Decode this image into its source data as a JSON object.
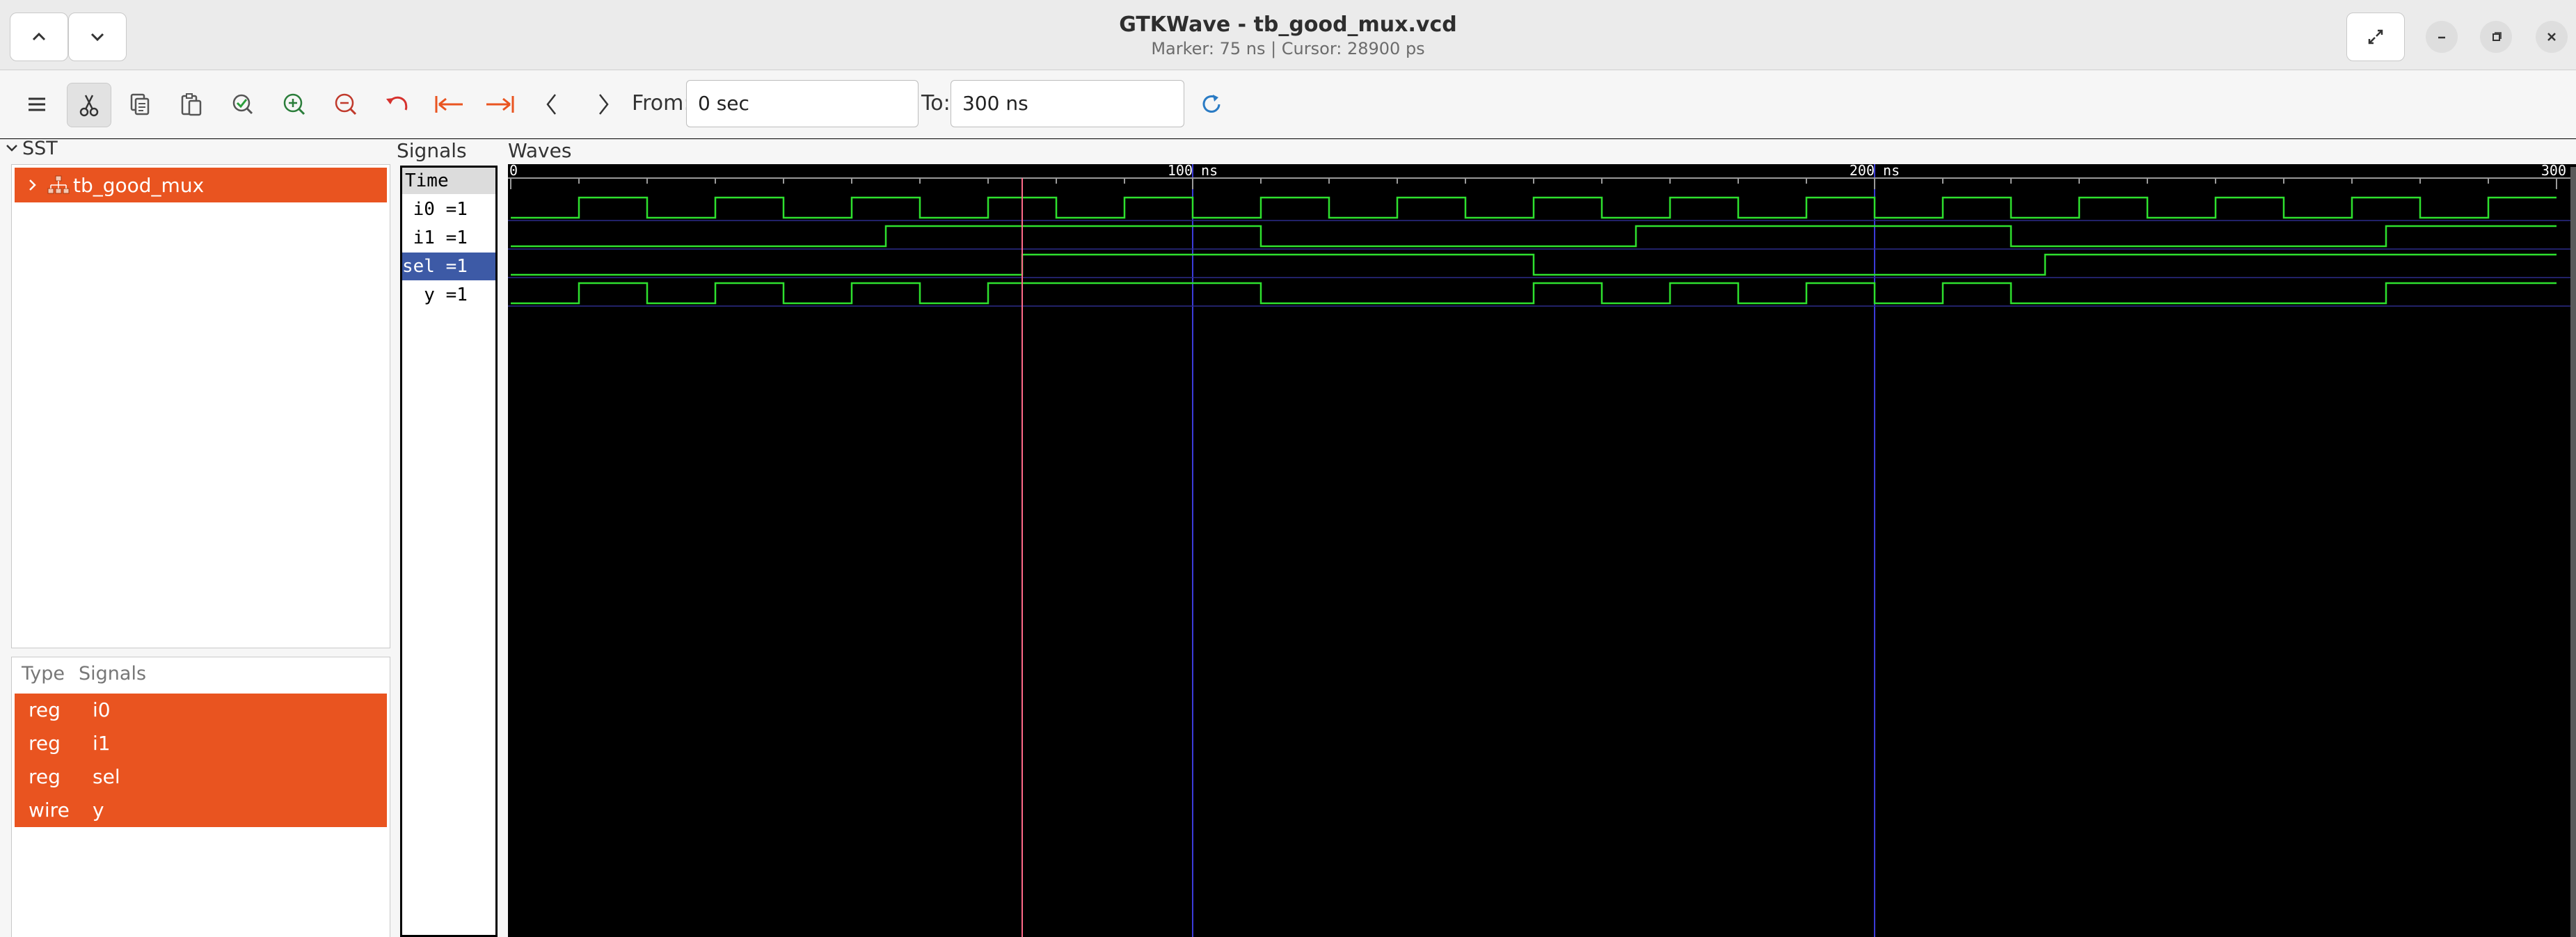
{
  "window": {
    "title": "GTKWave - tb_good_mux.vcd",
    "subtitle": "Marker: 75 ns  |  Cursor: 28900 ps"
  },
  "toolbar": {
    "from_label": "From:",
    "from_value": "0 sec",
    "to_label": "To:",
    "to_value": "300 ns"
  },
  "sst": {
    "label": "SST",
    "tree_item": "tb_good_mux"
  },
  "signal_list": {
    "type_header": "Type",
    "signals_header": "Signals",
    "rows": [
      {
        "type": "reg",
        "name": "i0"
      },
      {
        "type": "reg",
        "name": "i1"
      },
      {
        "type": "reg",
        "name": "sel"
      },
      {
        "type": "wire",
        "name": "y"
      }
    ]
  },
  "signals_pane": {
    "label": "Signals",
    "time_header": "Time",
    "rows": [
      {
        "text": " i0 =1",
        "selected": false
      },
      {
        "text": " i1 =1",
        "selected": false
      },
      {
        "text": "sel =1",
        "selected": true
      },
      {
        "text": "  y =1",
        "selected": false
      }
    ]
  },
  "waves": {
    "label": "Waves",
    "time_unit": "ns",
    "range": [
      0,
      300
    ],
    "ticks": [
      {
        "t": 0,
        "label": "0"
      },
      {
        "t": 100,
        "label": "100 ns"
      },
      {
        "t": 200,
        "label": "200 ns"
      },
      {
        "t": 300,
        "label": "300"
      }
    ],
    "marker_ns": 75,
    "colors": {
      "wave": "#2ee02e",
      "marker": "#ff6b8a",
      "grid": "#3b3bd9",
      "text": "#ffffff"
    },
    "signals": [
      {
        "name": "i0",
        "initial": 0,
        "transitions": [
          10,
          20,
          30,
          40,
          50,
          60,
          70,
          80,
          90,
          100,
          110,
          120,
          130,
          140,
          150,
          160,
          170,
          180,
          190,
          200,
          210,
          220,
          230,
          240,
          250,
          260,
          270,
          280,
          290,
          300
        ]
      },
      {
        "name": "i1",
        "initial": 0,
        "transitions": [
          55,
          110,
          165,
          220,
          275
        ]
      },
      {
        "name": "sel",
        "initial": 0,
        "transitions": [
          75,
          150,
          225
        ]
      },
      {
        "name": "y",
        "initial": 0,
        "transitions": [
          10,
          20,
          30,
          40,
          50,
          60,
          70,
          110,
          150,
          160,
          170,
          180,
          190,
          200,
          210,
          220,
          275
        ]
      }
    ]
  }
}
